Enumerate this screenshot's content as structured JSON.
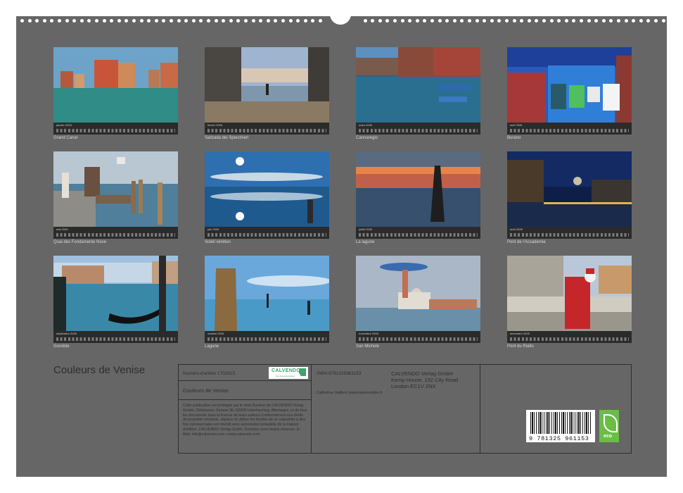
{
  "calendar_title": "Couleurs de Venise",
  "months": [
    {
      "month": "janvier 2026",
      "caption": "Grand Canal"
    },
    {
      "month": "février 2026",
      "caption": "Salizada dei Specchieri"
    },
    {
      "month": "mars 2026",
      "caption": "Cannaregio"
    },
    {
      "month": "avril 2026",
      "caption": "Burano"
    },
    {
      "month": "mai 2026",
      "caption": "Quai des Fondamente Nove"
    },
    {
      "month": "juin 2026",
      "caption": "Soleil vénitien"
    },
    {
      "month": "juillet 2026",
      "caption": "La lagune"
    },
    {
      "month": "août 2026",
      "caption": "Pont de l'Accademia"
    },
    {
      "month": "septembre 2026",
      "caption": "Gondole"
    },
    {
      "month": "octobre 2026",
      "caption": "Lagune"
    },
    {
      "month": "novembre 2026",
      "caption": "San Michele"
    },
    {
      "month": "décembre 2026",
      "caption": "Pont du Rialto"
    }
  ],
  "info": {
    "article_number": "Numéro d'article 1702915",
    "product_title": "Couleurs de Venise",
    "legal_text": "Cette publication est protégée par le droit d'auteur de CALVENDO Verlag GmbH, Ohlstrasser Strasse 36, 82008 Unterhaching, Allemagne, et de tous les documents sous la licence de leurs auteurs.Conformément aux droits de propriété existants, séparer et utiliser les feuilles de ce calendrier à des fins commerciales est interdit sans autorisation préalable de la maison d'édition. CALVENDO Verlag GmbH. Données sous toutes réserves. E-Mail: info@calvendo.com • www.calvendo.com",
    "isbn": "ISBN 9781325961153",
    "publisher": [
      "CALVENDO Verlag GmbH",
      "Kemp House, 152 City Road",
      "London EC1V 2NX"
    ],
    "author": "Catherine Galliero www.lavienvisible.fr",
    "logo_text": "CALVENDO",
    "logo_subtitle": "Des Sammlerstücke",
    "barcode_number": "9 781325 961153",
    "eco_label": "eco"
  }
}
